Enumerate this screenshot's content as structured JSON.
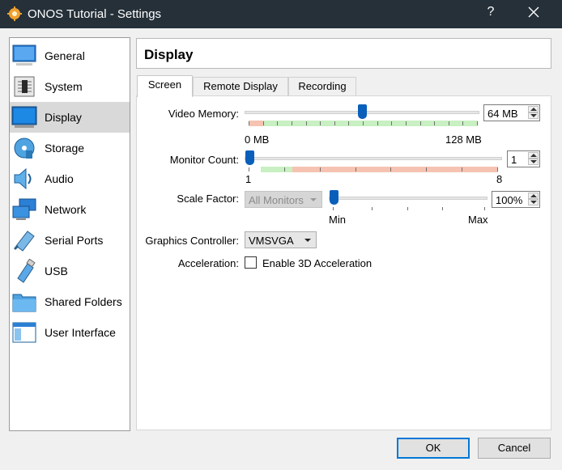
{
  "window": {
    "title": "ONOS Tutorial - Settings",
    "help_label": "?"
  },
  "sidebar": {
    "items": [
      {
        "label": "General",
        "icon": "general-icon"
      },
      {
        "label": "System",
        "icon": "system-chip-icon"
      },
      {
        "label": "Display",
        "icon": "display-monitor-icon",
        "selected": true
      },
      {
        "label": "Storage",
        "icon": "storage-disc-icon"
      },
      {
        "label": "Audio",
        "icon": "audio-speaker-icon"
      },
      {
        "label": "Network",
        "icon": "network-icon"
      },
      {
        "label": "Serial Ports",
        "icon": "serial-port-icon"
      },
      {
        "label": "USB",
        "icon": "usb-icon"
      },
      {
        "label": "Shared Folders",
        "icon": "folder-icon"
      },
      {
        "label": "User Interface",
        "icon": "user-interface-icon"
      }
    ]
  },
  "header": {
    "title": "Display"
  },
  "tabs": [
    {
      "label": "Screen",
      "active": true
    },
    {
      "label": "Remote Display"
    },
    {
      "label": "Recording"
    }
  ],
  "screen": {
    "video_memory": {
      "label": "Video Memory:",
      "value": "64 MB",
      "min_label": "0 MB",
      "max_label": "128 MB",
      "level": 0.5
    },
    "monitor_count": {
      "label": "Monitor Count:",
      "value": "1",
      "min_label": "1",
      "max_label": "8",
      "level": 0
    },
    "scale_factor": {
      "label": "Scale Factor:",
      "monitor_select": "All Monitors",
      "value": "100%",
      "min_label": "Min",
      "max_label": "Max",
      "level": 0
    },
    "graphics_controller": {
      "label": "Graphics Controller:",
      "value": "VMSVGA"
    },
    "acceleration": {
      "label": "Acceleration:",
      "checkbox_label": "Enable 3D Acceleration",
      "checked": false
    }
  },
  "buttons": {
    "ok": "OK",
    "cancel": "Cancel"
  },
  "colors": {
    "titlebar": "#253039",
    "selection": "#d9d9d9",
    "accent": "#0078d7",
    "slider_handle": "#0a5fba"
  }
}
